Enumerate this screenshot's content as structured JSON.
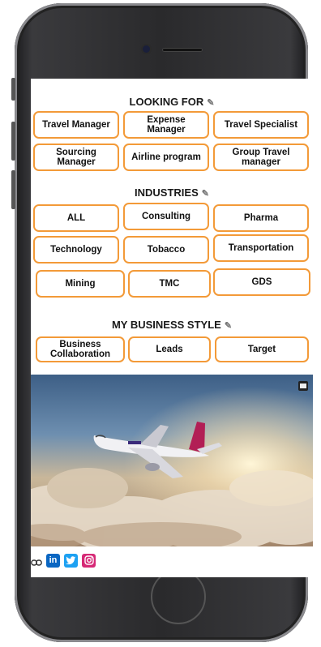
{
  "sections": {
    "looking_for": {
      "title": "LOOKING FOR",
      "chips": [
        "Travel Manager",
        "Expense Manager",
        "Travel Specialist",
        "Sourcing Manager",
        "Airline program",
        "Group Travel manager"
      ]
    },
    "industries": {
      "title": "INDUSTRIES",
      "chips": [
        "ALL",
        "Consulting",
        "Pharma",
        "Technology",
        "Tobacco",
        "Transportation",
        "Mining",
        "TMC",
        "GDS"
      ]
    },
    "business_style": {
      "title": "MY BUSINESS STYLE",
      "chips": [
        "Business Collaboration",
        "Leads",
        "Target"
      ]
    }
  },
  "footer": {
    "icons": [
      "link-icon",
      "linkedin-icon",
      "twitter-icon",
      "instagram-icon"
    ],
    "linkedin_text": "in"
  },
  "colors": {
    "accent": "#f39a38",
    "linkedin": "#0a66c2",
    "twitter": "#1da1f2",
    "instagram": "#d62976"
  }
}
